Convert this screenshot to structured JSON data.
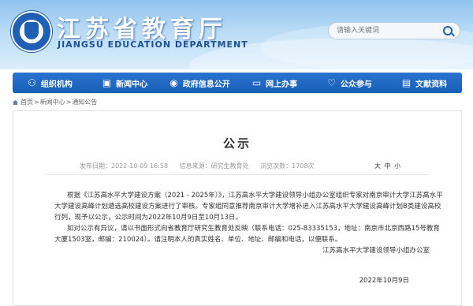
{
  "header": {
    "title": "江苏省教育厅",
    "subtitle": "JIANGSU EDUCATION DEPARTMENT",
    "search_placeholder": "请输入关键词"
  },
  "nav": [
    {
      "label": "组织机构",
      "icon": "org-chart-icon",
      "glyph": "⚇"
    },
    {
      "label": "新闻中心",
      "icon": "news-icon",
      "glyph": "▣"
    },
    {
      "label": "政府信息公开",
      "icon": "info-icon",
      "glyph": "◉"
    },
    {
      "label": "网上办事",
      "icon": "computer-icon",
      "glyph": "▭"
    },
    {
      "label": "公众参与",
      "icon": "heart-icon",
      "glyph": "♡"
    },
    {
      "label": "文献资料",
      "icon": "documents-icon",
      "glyph": "▤"
    }
  ],
  "breadcrumb": [
    "首页",
    "新闻中心",
    "通知公告"
  ],
  "article": {
    "title": "公示",
    "published": "发布日期：2022-10-09 16:58",
    "source": "信息来源：研究生教育处",
    "views": "浏览次数：1708次",
    "font_size_options": [
      "大",
      "中",
      "小"
    ],
    "paragraphs": [
      "根据《江苏高水平大学建设方案（2021 - 2025年）》，江苏高水平大学建设领导小组办公室组织专家对南京审计大学江苏高水平大学建设高峰计划遴选高校建设方案进行了审核。专家组同意推荐南京审计大学增补进入江苏高水平大学建设高峰计划B类建设高校行列，现予以公示，公示时间为2022年10月9日至10月13日。",
      "如对公示有异议，请以书面形式向省教育厅研究生教育处反映（联系电话：025-83335153，地址：南京市北京西路15号教育大厦1503室，邮编：210024）。请注明本人的真实姓名、单位、地址、邮编和电话，以便联系。"
    ],
    "signature_org": "江苏高水平大学建设领导小组办公室",
    "signature_date": "2022年10月9日"
  }
}
